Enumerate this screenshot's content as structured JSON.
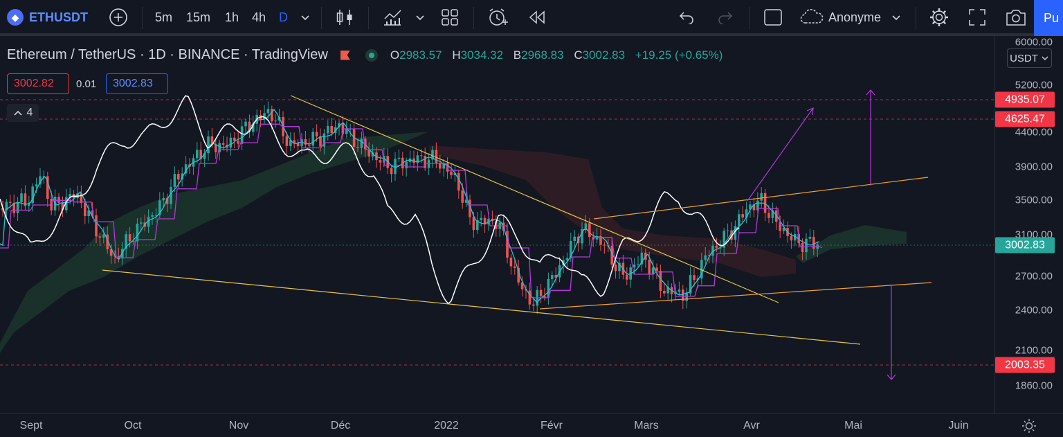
{
  "toolbar": {
    "symbol": "ETHUSDT",
    "intervals": [
      "5m",
      "15m",
      "1h",
      "4h",
      "D"
    ],
    "active_interval": "D",
    "layout_name": "Anonyme",
    "publish_label": "Pu"
  },
  "legend": {
    "title": "Ethereum / TetherUS · 1D · BINANCE · TradingView",
    "open_label": "O",
    "open": "2983.57",
    "high_label": "H",
    "high": "3034.32",
    "low_label": "B",
    "low": "2968.83",
    "close_label": "C",
    "close": "3002.83",
    "change": "+19.25 (+0.65%)",
    "bid": "3002.82",
    "spread": "0.01",
    "ask": "3002.83",
    "indicator_count": "4"
  },
  "price_axis": {
    "currency": "USDT",
    "labels": [
      "6000.00",
      "5200.00",
      "4400.00",
      "3900.00",
      "3500.00",
      "3100.00",
      "2700.00",
      "2400.00",
      "2100.00",
      "1860.00"
    ],
    "tags": [
      {
        "text": "4935.07",
        "color": "#f23645"
      },
      {
        "text": "4625.47",
        "color": "#f23645"
      },
      {
        "text": "3002.83",
        "color": "#26a69a"
      },
      {
        "text": "2003.35",
        "color": "#f23645"
      }
    ]
  },
  "time_axis": {
    "labels": [
      "Sept",
      "Oct",
      "Nov",
      "Déc",
      "2022",
      "Févr",
      "Mars",
      "Avr",
      "Mai",
      "Juin"
    ]
  },
  "colors": {
    "background": "#131722",
    "up": "#26a69a",
    "down": "#ef5350",
    "accent": "#2962ff"
  }
}
